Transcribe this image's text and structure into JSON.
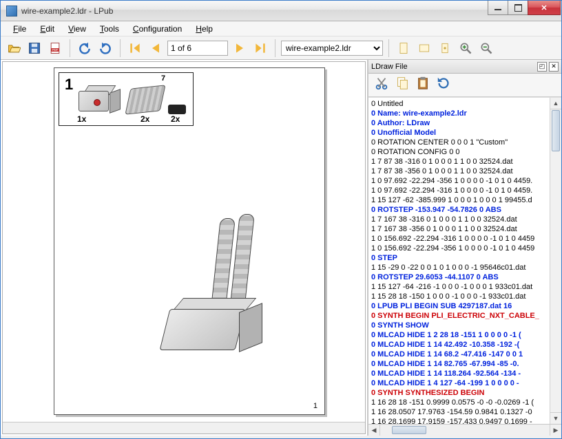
{
  "window": {
    "title": "wire-example2.ldr - LPub"
  },
  "menu": {
    "file": "File",
    "edit": "Edit",
    "view": "View",
    "tools": "Tools",
    "configuration": "Configuration",
    "help": "Help"
  },
  "toolbar": {
    "page_field": "1 of 6",
    "model_selected": "wire-example2.ldr"
  },
  "page": {
    "step_number": "1",
    "pli": {
      "qtyA": "1x",
      "qtyB": "2x",
      "qtyC": "2x",
      "lenB": "7"
    },
    "page_number": "1"
  },
  "dock": {
    "title": "LDraw File"
  },
  "ldraw_lines": [
    {
      "text": "0 Untitled",
      "cls": "c-black"
    },
    {
      "text": "0 Name: wire-example2.ldr",
      "cls": "c-blue"
    },
    {
      "text": "0 Author: LDraw",
      "cls": "c-blue"
    },
    {
      "text": "0 Unofficial Model",
      "cls": "c-blue"
    },
    {
      "text": "0 ROTATION CENTER 0 0 0 1 \"Custom\"",
      "cls": "c-black"
    },
    {
      "text": "0 ROTATION CONFIG 0 0",
      "cls": "c-black"
    },
    {
      "text": "1 7 87 38 -316 0 1 0 0 0 1 1 0 0 32524.dat",
      "cls": "c-black"
    },
    {
      "text": "1 7 87 38 -356 0 1 0 0 0 1 1 0 0 32524.dat",
      "cls": "c-black"
    },
    {
      "text": "1 0 97.692 -22.294 -356 1 0 0 0 0 -1 0 1 0 4459.",
      "cls": "c-black"
    },
    {
      "text": "1 0 97.692 -22.294 -316 1 0 0 0 0 -1 0 1 0 4459.",
      "cls": "c-black"
    },
    {
      "text": "1 15 127 -62 -385.999 1 0 0 0 1 0 0 0 1 99455.d",
      "cls": "c-black"
    },
    {
      "text": "0 ROTSTEP -153.947 -54.7826 0 ABS",
      "cls": "c-blue"
    },
    {
      "text": "1 7 167 38 -316 0 1 0 0 0 1 1 0 0 32524.dat",
      "cls": "c-black"
    },
    {
      "text": "1 7 167 38 -356 0 1 0 0 0 1 1 0 0 32524.dat",
      "cls": "c-black"
    },
    {
      "text": "1 0 156.692 -22.294 -316 1 0 0 0 0 -1 0 1 0 4459",
      "cls": "c-black"
    },
    {
      "text": "1 0 156.692 -22.294 -356 1 0 0 0 0 -1 0 1 0 4459",
      "cls": "c-black"
    },
    {
      "text": "0 STEP",
      "cls": "c-blue"
    },
    {
      "text": "1 15 -29 0 -22 0 0 1 0 1 0 0 0 -1 95646c01.dat",
      "cls": "c-black"
    },
    {
      "text": "0 ROTSTEP 29.6053 -44.1107 0 ABS",
      "cls": "c-blue"
    },
    {
      "text": "1 15 127 -64 -216 -1 0 0 0 -1 0 0 0 1 933c01.dat",
      "cls": "c-black"
    },
    {
      "text": "1 15 28 18 -150 1 0 0 0 -1 0 0 0 -1 933c01.dat",
      "cls": "c-black"
    },
    {
      "text": "0 LPUB PLI BEGIN SUB 4297187.dat 16",
      "cls": "c-blue"
    },
    {
      "text": "0 SYNTH BEGIN PLI_ELECTRIC_NXT_CABLE_",
      "cls": "c-red"
    },
    {
      "text": "0 SYNTH SHOW",
      "cls": "c-blue"
    },
    {
      "text": "0 MLCAD HIDE 1 2 28 18 -151 1 0 0 0 0 -1 (",
      "cls": "c-blue"
    },
    {
      "text": "0 MLCAD HIDE 1 14 42.492 -10.358 -192 -(",
      "cls": "c-blue"
    },
    {
      "text": "0 MLCAD HIDE 1 14 68.2 -47.416 -147 0 0 1",
      "cls": "c-blue"
    },
    {
      "text": "0 MLCAD HIDE 1 14 82.765 -67.994 -85 -0.",
      "cls": "c-blue"
    },
    {
      "text": "0 MLCAD HIDE 1 14 118.264 -92.564 -134 -",
      "cls": "c-blue"
    },
    {
      "text": "0 MLCAD HIDE 1 4 127 -64 -199 1 0 0 0 0 -",
      "cls": "c-blue"
    },
    {
      "text": "0 SYNTH SYNTHESIZED BEGIN",
      "cls": "c-red"
    },
    {
      "text": "1 16 28 18 -151 0.9999 0.0575 -0 -0 -0.0269 -1 (",
      "cls": "c-black"
    },
    {
      "text": "1 16 28.0507 17.9763 -154.59 0.9841 0.1327 -0",
      "cls": "c-black"
    },
    {
      "text": "1 16 28.1699 17.9159 -157.433 0.9497 0.1699 -",
      "cls": "c-black"
    }
  ]
}
